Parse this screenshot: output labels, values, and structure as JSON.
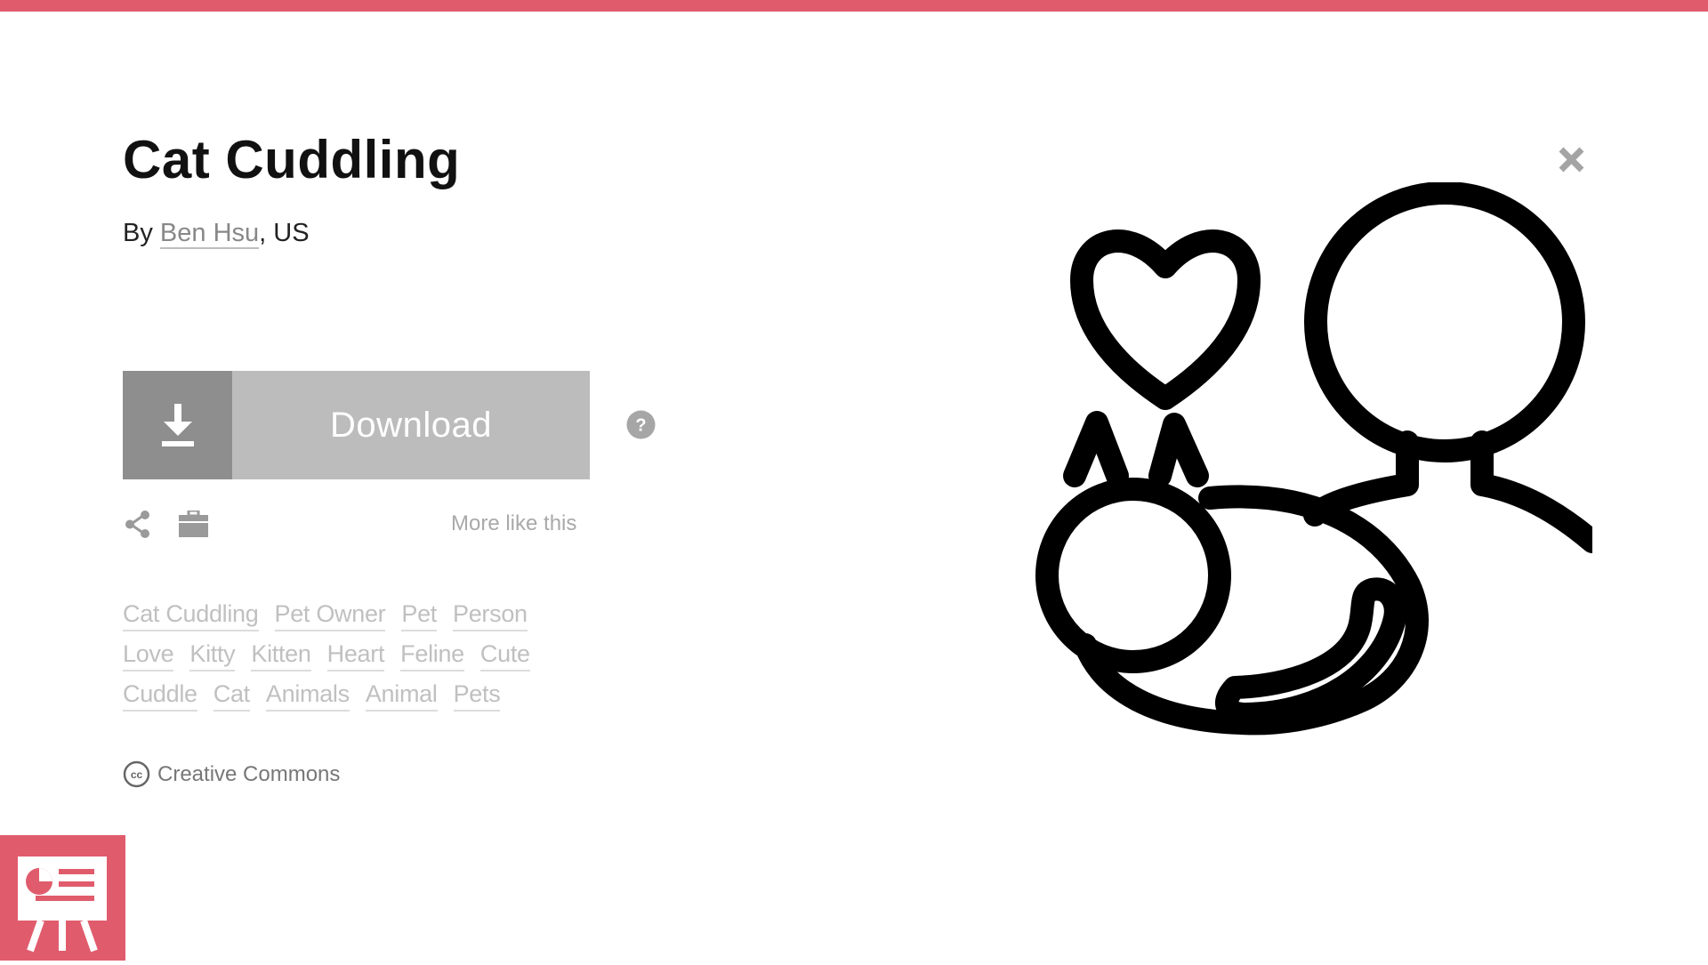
{
  "header": {
    "accent_color": "#e05c6d"
  },
  "icon_detail": {
    "title": "Cat Cuddling",
    "by_prefix": "By",
    "author": "Ben Hsu",
    "location_suffix": ", US"
  },
  "actions": {
    "download_label": "Download",
    "help_icon": "question-circle-icon",
    "share_icon": "share-icon",
    "collection_icon": "briefcase-icon",
    "more_like_this": "More like this"
  },
  "tags": [
    [
      "Cat Cuddling",
      "Pet Owner",
      "Pet",
      "Person"
    ],
    [
      "Love",
      "Kitty",
      "Kitten",
      "Heart",
      "Feline",
      "Cute"
    ],
    [
      "Cuddle",
      "Cat",
      "Animals",
      "Animal",
      "Pets"
    ]
  ],
  "license": {
    "icon": "creative-commons-icon",
    "label": "Creative Commons"
  },
  "artwork": {
    "subject": "cat-cuddling-icon"
  },
  "controls": {
    "close_icon": "close-icon"
  },
  "brand": {
    "icon": "presentation-board-logo-icon",
    "color": "#e05c6d"
  }
}
